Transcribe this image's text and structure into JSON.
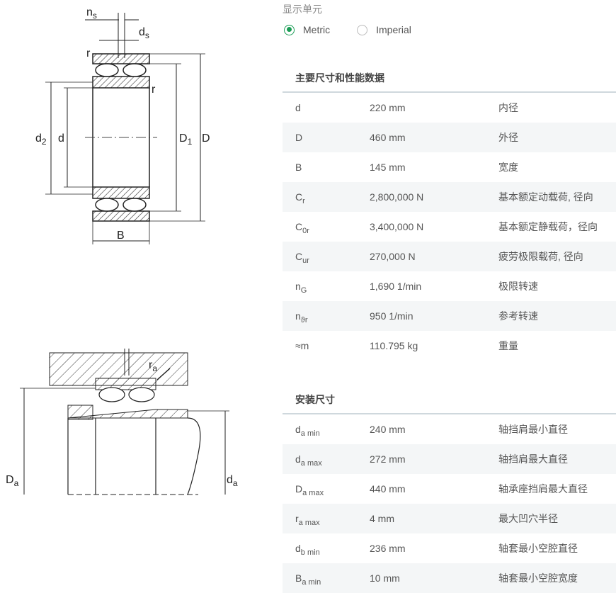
{
  "drawing_labels": {
    "ns": {
      "main": "n",
      "sub": "s"
    },
    "ds": {
      "main": "d",
      "sub": "s"
    },
    "r1": "r",
    "r2": "r",
    "d2": {
      "main": "d",
      "sub": "2"
    },
    "d": "d",
    "D1": {
      "main": "D",
      "sub": "1"
    },
    "D": "D",
    "B": "B",
    "ra": {
      "main": "r",
      "sub": "a"
    },
    "Da": {
      "main": "D",
      "sub": "a"
    },
    "da": {
      "main": "d",
      "sub": "a"
    }
  },
  "units": {
    "title": "显示单元",
    "options": [
      {
        "label": "Metric",
        "checked": true
      },
      {
        "label": "Imperial",
        "checked": false
      }
    ]
  },
  "main_dims": {
    "title": "主要尺寸和性能数据",
    "rows": [
      {
        "sym": "d",
        "sub": "",
        "value": "220 mm",
        "desc": "内径"
      },
      {
        "sym": "D",
        "sub": "",
        "value": "460 mm",
        "desc": "外径"
      },
      {
        "sym": "B",
        "sub": "",
        "value": "145 mm",
        "desc": "宽度"
      },
      {
        "sym": "C",
        "sub": "r",
        "value": "2,800,000 N",
        "desc": "基本额定动载荷, 径向"
      },
      {
        "sym": "C",
        "sub": "0r",
        "value": "3,400,000 N",
        "desc": "基本额定静载荷，径向"
      },
      {
        "sym": "C",
        "sub": "ur",
        "value": "270,000 N",
        "desc": "疲劳极限载荷, 径向"
      },
      {
        "sym": "n",
        "sub": "G",
        "value": "1,690 1/min",
        "desc": "极限转速"
      },
      {
        "sym": "n",
        "sub": "ϑr",
        "value": "950 1/min",
        "desc": "参考转速"
      },
      {
        "sym": "≈m",
        "sub": "",
        "value": "110.795 kg",
        "desc": "重量"
      }
    ]
  },
  "mount_dims": {
    "title": "安装尺寸",
    "rows": [
      {
        "sym": "d",
        "sub": "a min",
        "value": "240 mm",
        "desc": "轴挡肩最小直径"
      },
      {
        "sym": "d",
        "sub": "a max",
        "value": "272 mm",
        "desc": "轴挡肩最大直径"
      },
      {
        "sym": "D",
        "sub": "a max",
        "value": "440 mm",
        "desc": "轴承座挡肩最大直径"
      },
      {
        "sym": "r",
        "sub": "a max",
        "value": "4 mm",
        "desc": "最大凹穴半径"
      },
      {
        "sym": "d",
        "sub": "b min",
        "value": "236 mm",
        "desc": "轴套最小空腔直径"
      },
      {
        "sym": "B",
        "sub": "a min",
        "value": "10 mm",
        "desc": "轴套最小空腔宽度"
      }
    ]
  }
}
